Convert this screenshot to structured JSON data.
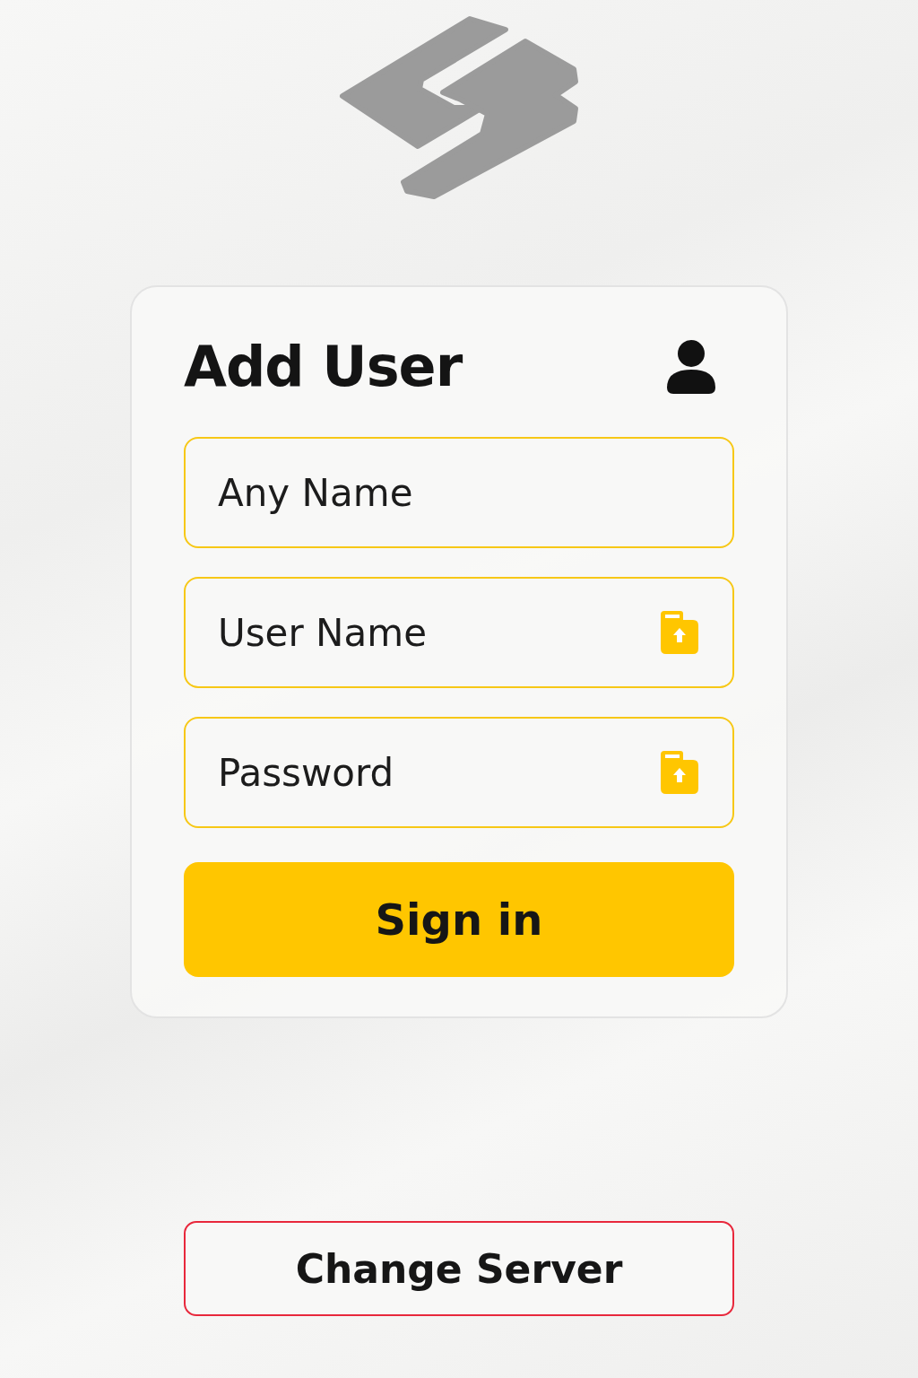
{
  "card": {
    "title": "Add User"
  },
  "fields": [
    {
      "placeholder": "Any Name",
      "kind": "plain"
    },
    {
      "placeholder": "User Name",
      "kind": "secure"
    },
    {
      "placeholder": "Password",
      "kind": "secure"
    }
  ],
  "primary_button": "Sign in",
  "secondary_button": "Change Server"
}
